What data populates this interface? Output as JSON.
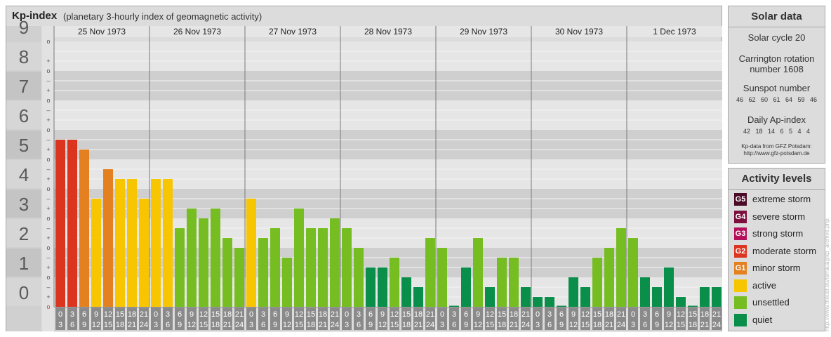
{
  "header": {
    "title": "Kp-index",
    "subtitle": "(planetary 3-hourly index of geomagnetic activity)"
  },
  "chart_data": {
    "type": "bar",
    "title": "Kp-index",
    "subtitle": "(planetary 3-hourly index of geomagnetic activity)",
    "ylim": [
      0,
      9
    ],
    "y_ticks": [
      "0",
      "1",
      "2",
      "3",
      "4",
      "5",
      "6",
      "7",
      "8",
      "9"
    ],
    "minor_marks": [
      "o",
      "+",
      "–"
    ],
    "days": [
      "25 Nov 1973",
      "26 Nov 1973",
      "27 Nov 1973",
      "28 Nov 1973",
      "29 Nov 1973",
      "30 Nov 1973",
      "1 Dec 1973"
    ],
    "interval_start_hours": [
      "0",
      "3",
      "6",
      "9",
      "12",
      "15",
      "18",
      "21"
    ],
    "interval_end_hours": [
      "3",
      "6",
      "9",
      "12",
      "15",
      "18",
      "21",
      "24"
    ],
    "values": [
      [
        5.667,
        5.667,
        5.333,
        3.667,
        4.667,
        4.333,
        4.333,
        3.667
      ],
      [
        4.333,
        4.333,
        2.667,
        3.333,
        3.0,
        3.333,
        2.333,
        2.0
      ],
      [
        3.667,
        2.333,
        2.667,
        1.667,
        3.333,
        2.667,
        2.667,
        3.0
      ],
      [
        2.667,
        2.0,
        1.333,
        1.333,
        1.667,
        1.0,
        0.667,
        2.333
      ],
      [
        2.0,
        0.0,
        1.333,
        2.333,
        0.667,
        1.667,
        1.667,
        0.667
      ],
      [
        0.333,
        0.333,
        0.0,
        1.0,
        0.667,
        1.667,
        2.0,
        2.667
      ],
      [
        2.333,
        1.0,
        0.667,
        1.333,
        0.333,
        0.0,
        0.667,
        0.667
      ]
    ],
    "level_colors": {
      "quiet": "#0a8f4a",
      "unsettled": "#76bd22",
      "active": "#f7c600",
      "minor_storm": "#e48020",
      "moderate_storm": "#db3520",
      "strong_storm": "#b50f5b",
      "severe_storm": "#7d0f3f",
      "extreme_storm": "#4a0a28"
    },
    "grid": true
  },
  "solar": {
    "title": "Solar data",
    "cycle": "Solar cycle 20",
    "carrington_line1": "Carrington rotation",
    "carrington_line2": "number 1608",
    "sunspot_title": "Sunspot number",
    "sunspot_values": "46 62 60 61 64 59 46",
    "ap_title": "Daily Ap-index",
    "ap_values": "42 18 14 6 5 4 4",
    "credit_line1": "Kp-data from GFZ Potsdam:",
    "credit_line2": "http://www.gfz-potsdam.de"
  },
  "levels": {
    "title": "Activity levels",
    "items": [
      {
        "code": "G5",
        "label": "extreme storm",
        "color": "#4a0a28"
      },
      {
        "code": "G4",
        "label": "severe storm",
        "color": "#7d0f3f"
      },
      {
        "code": "G3",
        "label": "strong storm",
        "color": "#b50f5b"
      },
      {
        "code": "G2",
        "label": "moderate storm",
        "color": "#db3520"
      },
      {
        "code": "G1",
        "label": "minor storm",
        "color": "#e48020"
      },
      {
        "code": "",
        "label": "active",
        "color": "#f7c600"
      },
      {
        "code": "",
        "label": "unsettled",
        "color": "#76bd22"
      },
      {
        "code": "",
        "label": "quiet",
        "color": "#0a8f4a"
      }
    ]
  },
  "source_url": "http://www.theusr.eu/terrauag/kp_archive.php"
}
